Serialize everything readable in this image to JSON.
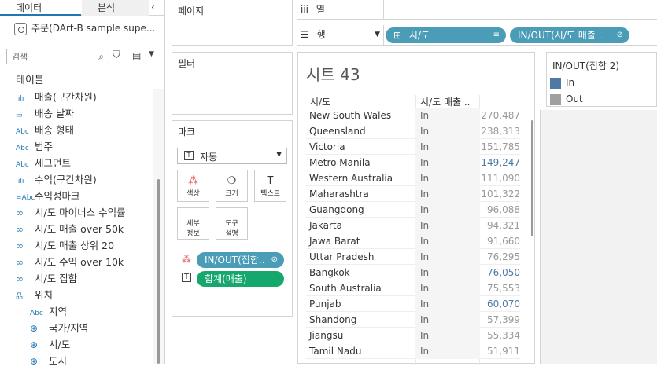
{
  "datapane": {
    "tabs": [
      "데이터",
      "분석"
    ],
    "collapse_glyph": "‹",
    "datasource": "주문(DArt-B sample supe...",
    "search_placeholder": "검색",
    "section_title": "테이블",
    "fields": [
      {
        "label": "매출(구간차원)",
        "icon": ".ılı",
        "type": "bin"
      },
      {
        "label": "배송 날짜",
        "icon": "▭",
        "type": "date"
      },
      {
        "label": "배송 형태",
        "icon": "Abc",
        "type": "string"
      },
      {
        "label": "범주",
        "icon": "Abc",
        "type": "string"
      },
      {
        "label": "세그먼트",
        "icon": "Abc",
        "type": "string"
      },
      {
        "label": "수익(구간차원)",
        "icon": ".ılı",
        "type": "bin"
      },
      {
        "label": "수익성마크",
        "icon": "=Abc",
        "type": "calc"
      },
      {
        "label": "시/도 마이너스 수익률",
        "icon": "∞",
        "type": "set"
      },
      {
        "label": "시/도 매출 over 50k",
        "icon": "∞",
        "type": "set"
      },
      {
        "label": "시/도 매출 상위 20",
        "icon": "∞",
        "type": "set"
      },
      {
        "label": "시/도 수익 over 10k",
        "icon": "∞",
        "type": "set"
      },
      {
        "label": "시/도 집합",
        "icon": "∞",
        "type": "set"
      },
      {
        "label": "위치",
        "icon": "品",
        "type": "hierarchy"
      },
      {
        "label": "지역",
        "icon": "Abc",
        "type": "string"
      },
      {
        "label": "국가/지역",
        "icon": "⊕",
        "type": "geo"
      },
      {
        "label": "시/도",
        "icon": "⊕",
        "type": "geo"
      },
      {
        "label": "도시",
        "icon": "⊕",
        "type": "geo"
      }
    ]
  },
  "shelves": {
    "pages_title": "페이지",
    "filters_title": "필터",
    "marks_title": "마크",
    "mark_type": "자동",
    "mark_buttons": [
      {
        "label": "색상",
        "icon": "⁂"
      },
      {
        "label": "크기",
        "icon": "❍"
      },
      {
        "label": "텍스트",
        "icon": "T"
      },
      {
        "label": "세부\n정보",
        "icon": ""
      },
      {
        "label": "도구\n설명",
        "icon": ""
      }
    ],
    "marks_pills": [
      {
        "label": "IN/OUT(집합..",
        "end": "⊘",
        "color": "blue"
      },
      {
        "label": "합계(매출)",
        "end": "",
        "color": "green"
      }
    ],
    "columns_label": "열",
    "rows_label": "행",
    "row_pills": [
      {
        "label": "시/도",
        "end": "≡",
        "prefix": "⊞"
      },
      {
        "label": "IN/OUT(시/도 매출 ..",
        "end": "⊘",
        "prefix": ""
      }
    ]
  },
  "sheet": {
    "title": "시트 43",
    "headers": [
      "시/도",
      "시/도 매출 .."
    ],
    "rows": [
      [
        "New South Wales",
        "In",
        "270,487"
      ],
      [
        "Queensland",
        "In",
        "238,313"
      ],
      [
        "Victoria",
        "In",
        "151,785"
      ],
      [
        "Metro Manila",
        "In",
        "149,247"
      ],
      [
        "Western Australia",
        "In",
        "111,090"
      ],
      [
        "Maharashtra",
        "In",
        "101,322"
      ],
      [
        "Guangdong",
        "In",
        "96,088"
      ],
      [
        "Jakarta",
        "In",
        "94,321"
      ],
      [
        "Jawa Barat",
        "In",
        "91,660"
      ],
      [
        "Uttar Pradesh",
        "In",
        "76,295"
      ],
      [
        "Bangkok",
        "In",
        "76,050"
      ],
      [
        "South Australia",
        "In",
        "75,553"
      ],
      [
        "Punjab",
        "In",
        "60,070"
      ],
      [
        "Shandong",
        "In",
        "57,399"
      ],
      [
        "Jiangsu",
        "In",
        "55,334"
      ],
      [
        "Tamil Nadu",
        "In",
        "51,911"
      ]
    ],
    "value_color_default": "#9a9a9a",
    "value_color_highlight": "#4e79a7"
  },
  "legend": {
    "title": "IN/OUT(집합 2)",
    "items": [
      {
        "label": "In",
        "color": "#4e79a7"
      },
      {
        "label": "Out",
        "color": "#a0a0a0"
      }
    ]
  }
}
